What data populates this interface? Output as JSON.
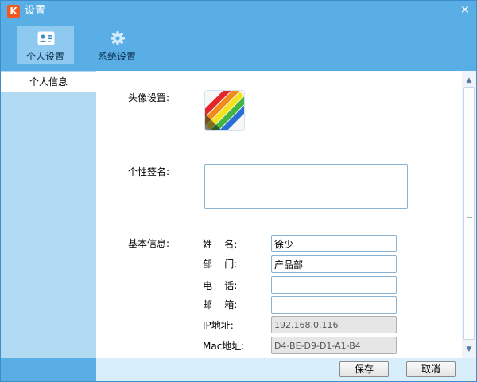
{
  "window": {
    "title": "设置",
    "app_icon_glyph": "K",
    "minimize_glyph": "—",
    "close_glyph": "✕",
    "accent": "#5aaee6"
  },
  "toolbar": {
    "tabs": [
      {
        "label": "个人设置",
        "icon": "id-card-icon",
        "active": true
      },
      {
        "label": "系统设置",
        "icon": "gear-icon",
        "active": false
      }
    ]
  },
  "sidebar": {
    "items": [
      {
        "label": "个人信息",
        "selected": true
      }
    ]
  },
  "form": {
    "avatar_label": "头像设置:",
    "signature_label": "个性签名:",
    "signature_value": "",
    "basic_label": "基本信息:",
    "fields": [
      {
        "label": "姓    名:",
        "value": "徐少",
        "readonly": false
      },
      {
        "label": "部    门:",
        "value": "产品部",
        "readonly": false
      },
      {
        "label": "电    话:",
        "value": "",
        "readonly": false
      },
      {
        "label": "邮    箱:",
        "value": "",
        "readonly": false
      },
      {
        "label": "IP地址:",
        "value": "192.168.0.116",
        "readonly": true
      },
      {
        "label": "Mac地址:",
        "value": "D4-BE-D9-D1-A1-B4",
        "readonly": true
      }
    ]
  },
  "scrollbar": {
    "up_glyph": "▲",
    "down_glyph": "▼"
  },
  "footer": {
    "save_label": "保存",
    "cancel_label": "取消"
  }
}
